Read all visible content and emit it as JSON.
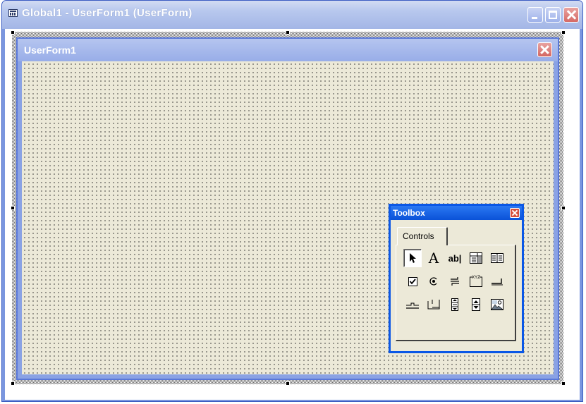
{
  "window": {
    "title": "Global1 - UserForm1 (UserForm)",
    "buttons": {
      "minimize": "minimize",
      "maximize": "maximize",
      "close": "close"
    }
  },
  "userform": {
    "title": "UserForm1"
  },
  "toolbox": {
    "title": "Toolbox",
    "tab_label": "Controls",
    "tools": [
      {
        "name": "select-objects",
        "icon": "pointer-icon"
      },
      {
        "name": "label",
        "icon": "label-a-icon",
        "glyph": "A"
      },
      {
        "name": "textbox",
        "icon": "textbox-icon",
        "glyph": "ab|"
      },
      {
        "name": "combobox",
        "icon": "combobox-icon"
      },
      {
        "name": "listbox",
        "icon": "listbox-icon"
      },
      {
        "name": "checkbox",
        "icon": "checkbox-icon"
      },
      {
        "name": "optionbutton",
        "icon": "option-button-icon"
      },
      {
        "name": "togglebutton",
        "icon": "toggle-button-icon"
      },
      {
        "name": "frame",
        "icon": "frame-icon",
        "glyph": "XYZ"
      },
      {
        "name": "commandbutton",
        "icon": "command-button-icon"
      },
      {
        "name": "tabstrip",
        "icon": "tabstrip-icon"
      },
      {
        "name": "multipage",
        "icon": "multipage-icon"
      },
      {
        "name": "scrollbar",
        "icon": "scrollbar-icon"
      },
      {
        "name": "spinbutton",
        "icon": "spin-button-icon"
      },
      {
        "name": "image",
        "icon": "image-icon"
      }
    ]
  },
  "colors": {
    "form_background": "#ece9d8",
    "toolbox_border": "#0a57e6",
    "caption_inactive": "#a3b6e6"
  }
}
